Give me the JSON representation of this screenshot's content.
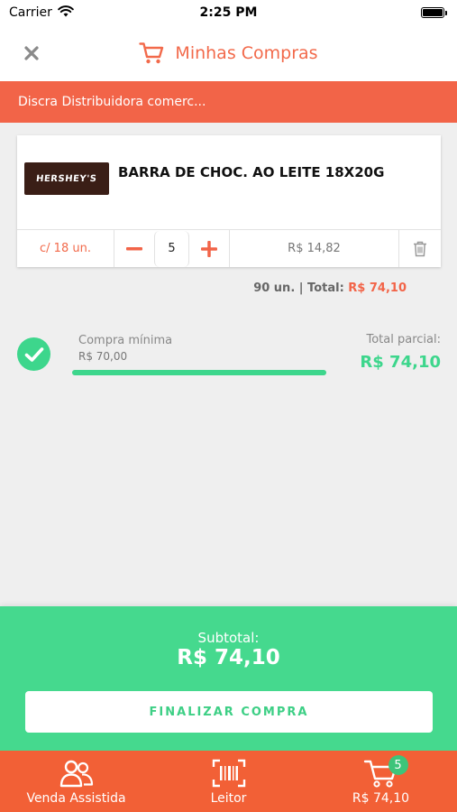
{
  "status_bar": {
    "carrier": "Carrier",
    "time": "2:25 PM"
  },
  "header": {
    "title": "Minhas Compras",
    "accent_color": "#f26a4b"
  },
  "banner": {
    "distributor": "Discra Distribuidora comerc..."
  },
  "cart_item": {
    "image_brand": "HERSHEY'S",
    "name": "BARRA DE CHOC. AO LEITE 18X20G",
    "pack": "c/ 18 un.",
    "quantity": "5",
    "unit_price": "R$ 14,82",
    "units_total": "90 un. | Total: ",
    "total": "R$ 74,10"
  },
  "minimum": {
    "label": "Compra mínima",
    "value": "R$ 70,00",
    "progress_fraction": 1.0,
    "partial_label": "Total parcial:",
    "partial_value": "R$ 74,10"
  },
  "checkout": {
    "subtotal_label": "Subtotal:",
    "subtotal_value": "R$ 74,10",
    "button_label": "FINALIZAR COMPRA",
    "panel_color": "#45d98e"
  },
  "tab_bar": {
    "color": "#f26036",
    "tabs": [
      {
        "label": "Venda Assistida",
        "icon": "users-icon"
      },
      {
        "label": "Leitor",
        "icon": "barcode-scanner-icon"
      },
      {
        "label": "R$ 74,10",
        "icon": "cart-icon",
        "badge": "5"
      }
    ]
  }
}
